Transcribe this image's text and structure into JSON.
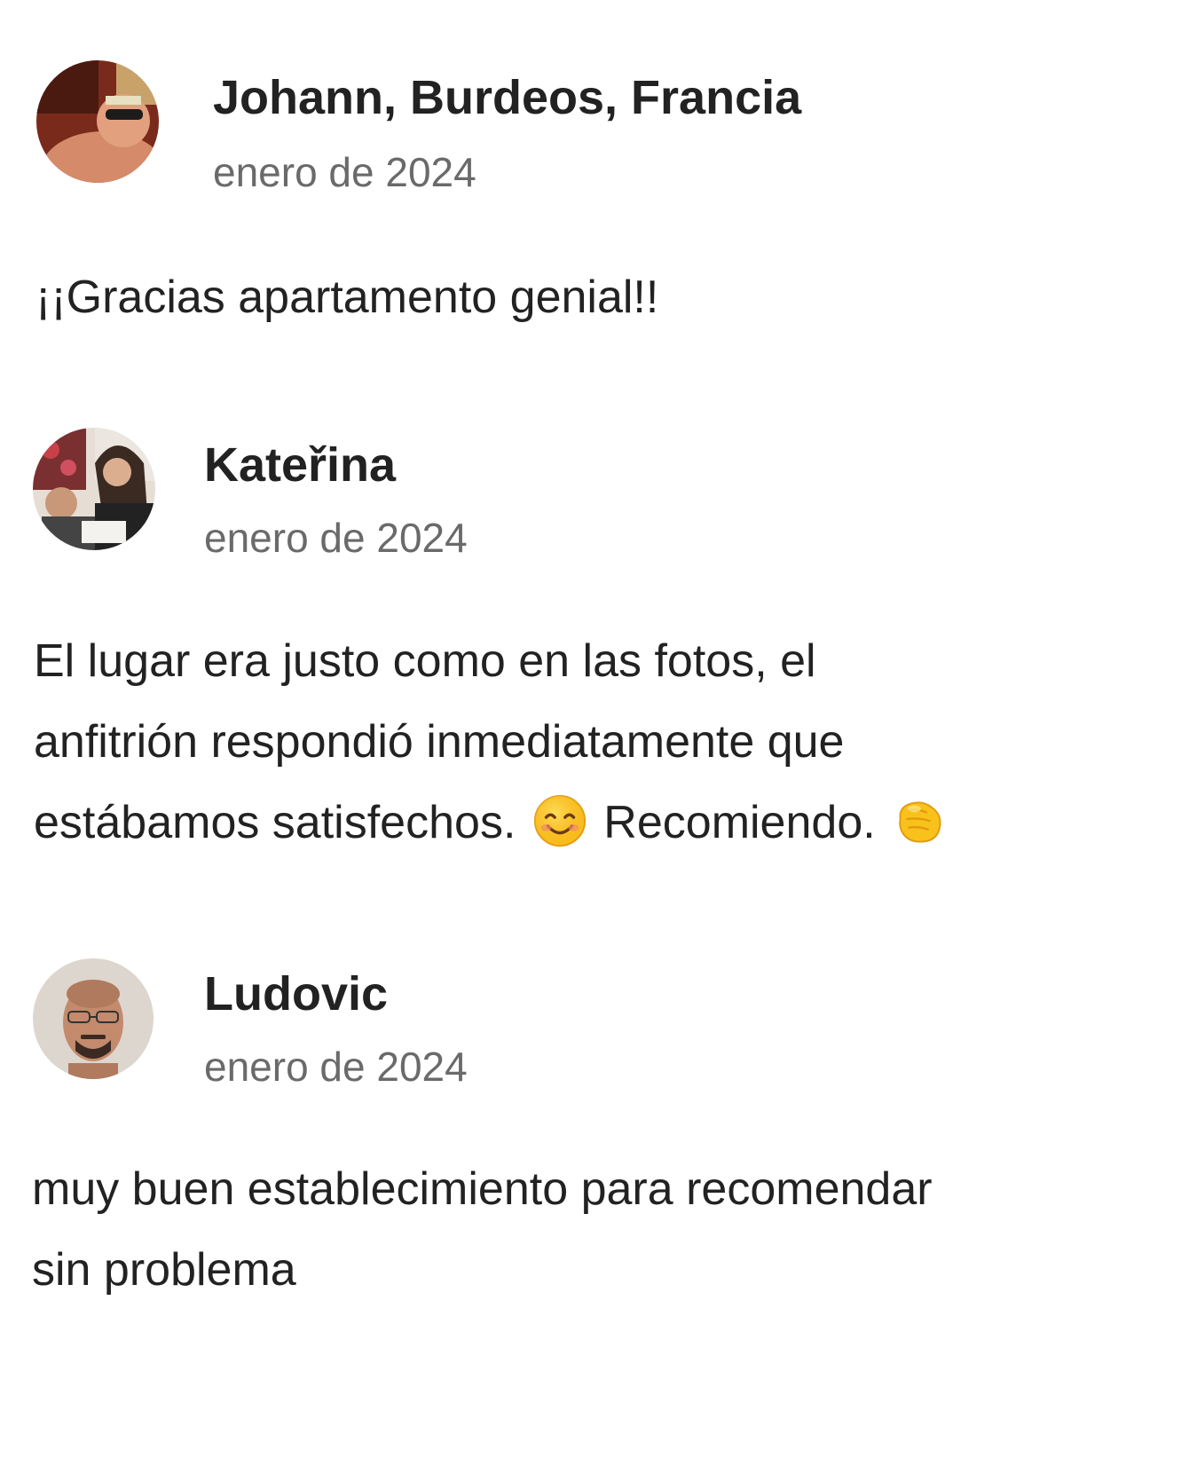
{
  "reviews": [
    {
      "name": "Johann, Burdeos, Francia",
      "date": "enero de 2024",
      "text_lines": [
        "¡¡Gracias apartamento genial!!"
      ]
    },
    {
      "name": "Kateřina",
      "date": "enero de 2024",
      "text_lines": [
        "El lugar era justo como en las fotos, el",
        "anfitrión respondió inmediatamente que"
      ],
      "text_line3_a": "estábamos satisfechos.",
      "text_line3_b": "Recomiendo.",
      "emojis": [
        "smiling-face-emoji",
        "fist-bump-emoji"
      ]
    },
    {
      "name": "Ludovic",
      "date": "enero de 2024",
      "text_lines": [
        "muy buen establecimiento para recomendar",
        "sin problema"
      ]
    }
  ],
  "colors": {
    "name": "#222222",
    "date": "#6a6a6a",
    "text": "#222222",
    "background": "#ffffff",
    "emoji_yellow": "#f9c21a"
  }
}
